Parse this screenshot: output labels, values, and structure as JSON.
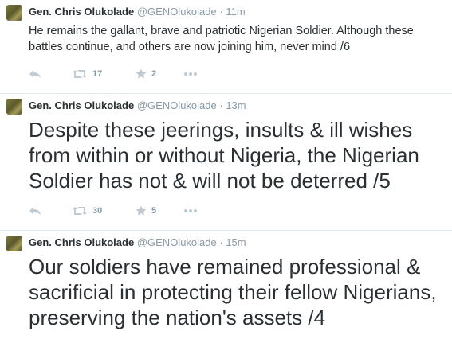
{
  "tweets": [
    {
      "name": "Gen. Chris Olukolade",
      "handle": "@GENOlukolade",
      "separator": "·",
      "time": "11m",
      "text": "He remains the gallant, brave and patriotic Nigerian Soldier. Although these battles continue, and others are now joining him, never mind /6",
      "retweets": "17",
      "favorites": "2"
    },
    {
      "name": "Gen. Chris Olukolade",
      "handle": "@GENOlukolade",
      "separator": "·",
      "time": "13m",
      "text": "Despite these jeerings, insults & ill wishes from within or without Nigeria, the Nigerian Soldier has not & will not be deterred /5",
      "retweets": "30",
      "favorites": "5"
    },
    {
      "name": "Gen. Chris Olukolade",
      "handle": "@GENOlukolade",
      "separator": "·",
      "time": "15m",
      "text": "Our soldiers have remained professional & sacrificial in protecting their fellow Nigerians, preserving the nation's assets /4"
    }
  ],
  "icons": {
    "reply": "reply-icon",
    "retweet": "retweet-icon",
    "favorite": "star-icon",
    "more": "more-icon"
  },
  "colors": {
    "text": "#292f33",
    "meta": "#8899a6",
    "divider": "#e1e8ed"
  }
}
